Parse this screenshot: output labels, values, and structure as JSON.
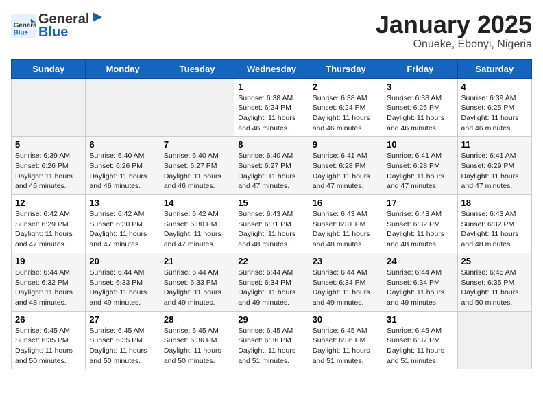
{
  "header": {
    "logo_line1": "General",
    "logo_line2": "Blue",
    "cal_title": "January 2025",
    "cal_subtitle": "Onueke, Ebonyi, Nigeria"
  },
  "days_of_week": [
    "Sunday",
    "Monday",
    "Tuesday",
    "Wednesday",
    "Thursday",
    "Friday",
    "Saturday"
  ],
  "weeks": [
    [
      {
        "day": "",
        "info": ""
      },
      {
        "day": "",
        "info": ""
      },
      {
        "day": "",
        "info": ""
      },
      {
        "day": "1",
        "info": "Sunrise: 6:38 AM\nSunset: 6:24 PM\nDaylight: 11 hours and 46 minutes."
      },
      {
        "day": "2",
        "info": "Sunrise: 6:38 AM\nSunset: 6:24 PM\nDaylight: 11 hours and 46 minutes."
      },
      {
        "day": "3",
        "info": "Sunrise: 6:38 AM\nSunset: 6:25 PM\nDaylight: 11 hours and 46 minutes."
      },
      {
        "day": "4",
        "info": "Sunrise: 6:39 AM\nSunset: 6:25 PM\nDaylight: 11 hours and 46 minutes."
      }
    ],
    [
      {
        "day": "5",
        "info": "Sunrise: 6:39 AM\nSunset: 6:26 PM\nDaylight: 11 hours and 46 minutes."
      },
      {
        "day": "6",
        "info": "Sunrise: 6:40 AM\nSunset: 6:26 PM\nDaylight: 11 hours and 46 minutes."
      },
      {
        "day": "7",
        "info": "Sunrise: 6:40 AM\nSunset: 6:27 PM\nDaylight: 11 hours and 46 minutes."
      },
      {
        "day": "8",
        "info": "Sunrise: 6:40 AM\nSunset: 6:27 PM\nDaylight: 11 hours and 47 minutes."
      },
      {
        "day": "9",
        "info": "Sunrise: 6:41 AM\nSunset: 6:28 PM\nDaylight: 11 hours and 47 minutes."
      },
      {
        "day": "10",
        "info": "Sunrise: 6:41 AM\nSunset: 6:28 PM\nDaylight: 11 hours and 47 minutes."
      },
      {
        "day": "11",
        "info": "Sunrise: 6:41 AM\nSunset: 6:29 PM\nDaylight: 11 hours and 47 minutes."
      }
    ],
    [
      {
        "day": "12",
        "info": "Sunrise: 6:42 AM\nSunset: 6:29 PM\nDaylight: 11 hours and 47 minutes."
      },
      {
        "day": "13",
        "info": "Sunrise: 6:42 AM\nSunset: 6:30 PM\nDaylight: 11 hours and 47 minutes."
      },
      {
        "day": "14",
        "info": "Sunrise: 6:42 AM\nSunset: 6:30 PM\nDaylight: 11 hours and 47 minutes."
      },
      {
        "day": "15",
        "info": "Sunrise: 6:43 AM\nSunset: 6:31 PM\nDaylight: 11 hours and 48 minutes."
      },
      {
        "day": "16",
        "info": "Sunrise: 6:43 AM\nSunset: 6:31 PM\nDaylight: 11 hours and 48 minutes."
      },
      {
        "day": "17",
        "info": "Sunrise: 6:43 AM\nSunset: 6:32 PM\nDaylight: 11 hours and 48 minutes."
      },
      {
        "day": "18",
        "info": "Sunrise: 6:43 AM\nSunset: 6:32 PM\nDaylight: 11 hours and 48 minutes."
      }
    ],
    [
      {
        "day": "19",
        "info": "Sunrise: 6:44 AM\nSunset: 6:32 PM\nDaylight: 11 hours and 48 minutes."
      },
      {
        "day": "20",
        "info": "Sunrise: 6:44 AM\nSunset: 6:33 PM\nDaylight: 11 hours and 49 minutes."
      },
      {
        "day": "21",
        "info": "Sunrise: 6:44 AM\nSunset: 6:33 PM\nDaylight: 11 hours and 49 minutes."
      },
      {
        "day": "22",
        "info": "Sunrise: 6:44 AM\nSunset: 6:34 PM\nDaylight: 11 hours and 49 minutes."
      },
      {
        "day": "23",
        "info": "Sunrise: 6:44 AM\nSunset: 6:34 PM\nDaylight: 11 hours and 49 minutes."
      },
      {
        "day": "24",
        "info": "Sunrise: 6:44 AM\nSunset: 6:34 PM\nDaylight: 11 hours and 49 minutes."
      },
      {
        "day": "25",
        "info": "Sunrise: 6:45 AM\nSunset: 6:35 PM\nDaylight: 11 hours and 50 minutes."
      }
    ],
    [
      {
        "day": "26",
        "info": "Sunrise: 6:45 AM\nSunset: 6:35 PM\nDaylight: 11 hours and 50 minutes."
      },
      {
        "day": "27",
        "info": "Sunrise: 6:45 AM\nSunset: 6:35 PM\nDaylight: 11 hours and 50 minutes."
      },
      {
        "day": "28",
        "info": "Sunrise: 6:45 AM\nSunset: 6:36 PM\nDaylight: 11 hours and 50 minutes."
      },
      {
        "day": "29",
        "info": "Sunrise: 6:45 AM\nSunset: 6:36 PM\nDaylight: 11 hours and 51 minutes."
      },
      {
        "day": "30",
        "info": "Sunrise: 6:45 AM\nSunset: 6:36 PM\nDaylight: 11 hours and 51 minutes."
      },
      {
        "day": "31",
        "info": "Sunrise: 6:45 AM\nSunset: 6:37 PM\nDaylight: 11 hours and 51 minutes."
      },
      {
        "day": "",
        "info": ""
      }
    ]
  ]
}
